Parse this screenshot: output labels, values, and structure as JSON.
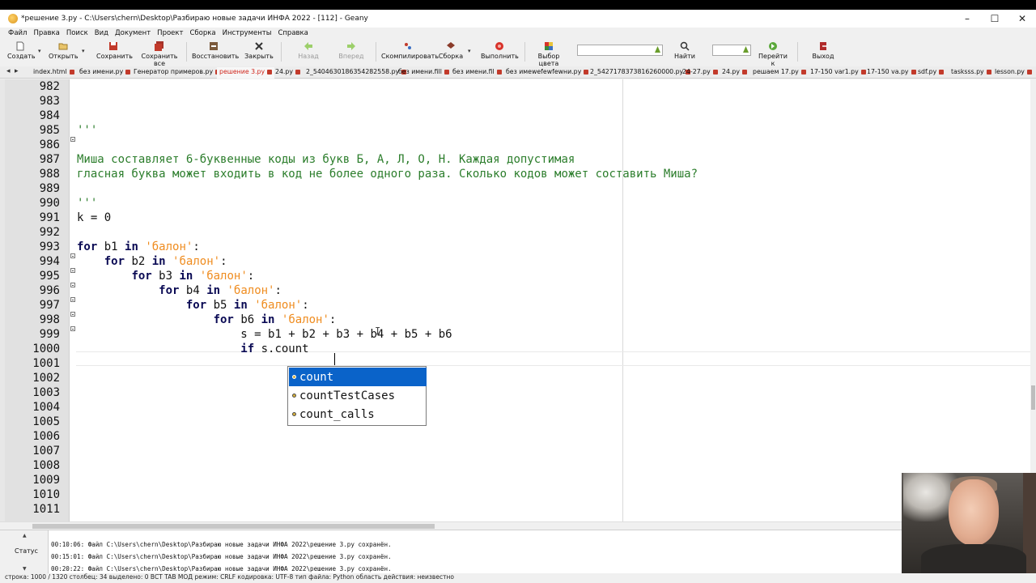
{
  "window": {
    "title": "*решение 3.py - C:\\Users\\chern\\Desktop\\Разбираю новые задачи ИНФА 2022 - [112] - Geany",
    "controls": [
      "–",
      "☐",
      "✕"
    ]
  },
  "menu": [
    "Файл",
    "Правка",
    "Поиск",
    "Вид",
    "Документ",
    "Проект",
    "Сборка",
    "Инструменты",
    "Справка"
  ],
  "toolbar": {
    "new": "Создать",
    "open": "Открыть",
    "save": "Сохранить",
    "save_all": "Сохранить все",
    "revert": "Восстановить",
    "close": "Закрыть",
    "back": "Назад",
    "forward": "Вперед",
    "compile": "Скомпилировать",
    "build": "Сборка",
    "execute": "Выполнить",
    "color": "Выбор цвета",
    "search_value": "",
    "find": "Найти",
    "goto_value": "",
    "goto": "Перейти к",
    "quit": "Выход"
  },
  "tabs": [
    "index.html",
    "без имени.py",
    "Генератор примеров.py",
    "решение 3.py",
    "24.py",
    "2_5404630186354282558.py",
    "без имени.fill",
    "без имени.fil",
    "без имеwefewfewни.py",
    "2_5427178373816260000.py",
    "24-27.py",
    "24.py",
    "решаем 17.py",
    "17-150 var1.py",
    "17-150 va.py",
    "sdf.py",
    "tasksss.py",
    "lesson.py"
  ],
  "active_tab": "решение 3.py",
  "line_numbers": [
    "982",
    "983",
    "984",
    "985",
    "986",
    "987",
    "988",
    "989",
    "990",
    "991",
    "992",
    "993",
    "994",
    "995",
    "996",
    "997",
    "998",
    "999",
    "1000",
    "1001",
    "1002",
    "1003",
    "1004",
    "1005",
    "1006",
    "1007",
    "1008",
    "1009",
    "1010",
    "1011"
  ],
  "code": {
    "l985": "'''",
    "l987": "Миша составляет 6-буквенные коды из букв Б, А, Л, О, Н. Каждая допустимая",
    "l988": "гласная буква может входить в код не более одного раза. Сколько кодов может составить Миша?",
    "l990": "'''",
    "l991": "k = 0",
    "kw_for": "for",
    "kw_in": "in",
    "kw_if": "if",
    "str_balon": "'балон'",
    "colon": ":",
    "var_b1": "b1",
    "var_b2": "b2",
    "var_b3": "b3",
    "var_b4": "b4",
    "var_b5": "b5",
    "var_b6": "b6",
    "l999": "s = b1 + b2 + b3 + b4 + b5 + b6",
    "l1000_rest": "s.count"
  },
  "autocomplete": {
    "items": [
      "count",
      "countTestCases",
      "count_calls"
    ],
    "selected": "count",
    "icon": "method-icon"
  },
  "messages": [
    "00:10:06: Файл C:\\Users\\chern\\Desktop\\Разбираю новые задачи ИНФА 2022\\решение 3.py сохранён.",
    "00:15:01: Файл C:\\Users\\chern\\Desktop\\Разбираю новые задачи ИНФА 2022\\решение 3.py сохранён.",
    "00:20:22: Файл C:\\Users\\chern\\Desktop\\Разбираю новые задачи ИНФА 2022\\решение 3.py сохранён."
  ],
  "message_panel_label": "Статус",
  "statusbar": "строка: 1000 / 1320     столбец: 34     выделено: 0     ВСТ     TAB     МОД     режим: CRLF     кодировка: UTF-8     тип файла: Python     область действия: неизвестно",
  "colors": {
    "keyword": "#0a0a54",
    "string": "#ef8c1f",
    "comment": "#2b7d2b",
    "active_tab": "#d0271d",
    "autocomplete_selection": "#0a63c9"
  }
}
